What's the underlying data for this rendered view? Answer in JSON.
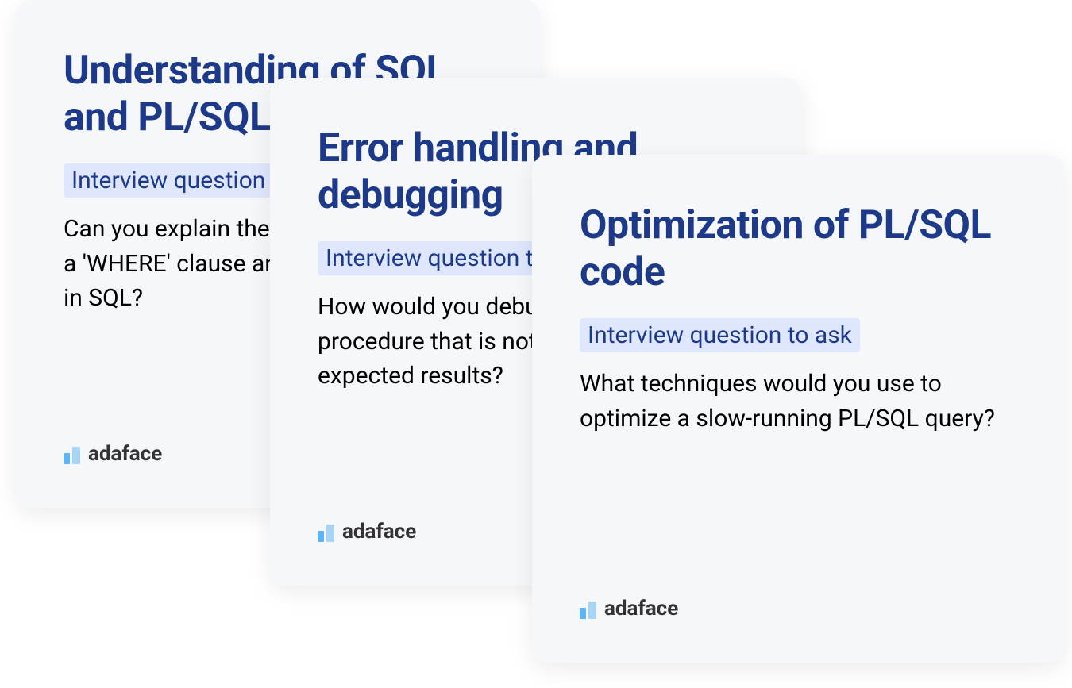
{
  "cards": [
    {
      "title": "Understanding of SQL and PL/SQL",
      "badge": "Interview question to ask",
      "question": "Can you explain the difference between a 'WHERE' clause and a 'HAVING' clause in SQL?",
      "brand": "adaface"
    },
    {
      "title": "Error handling and debugging",
      "badge": "Interview question to ask",
      "question": "How would you debug a PL/SQL stored procedure that is not returning the expected results?",
      "brand": "adaface"
    },
    {
      "title": "Optimization of PL/SQL code",
      "badge": "Interview question to ask",
      "question": "What techniques would you use to optimize a slow-running PL/SQL query?",
      "brand": "adaface"
    }
  ]
}
